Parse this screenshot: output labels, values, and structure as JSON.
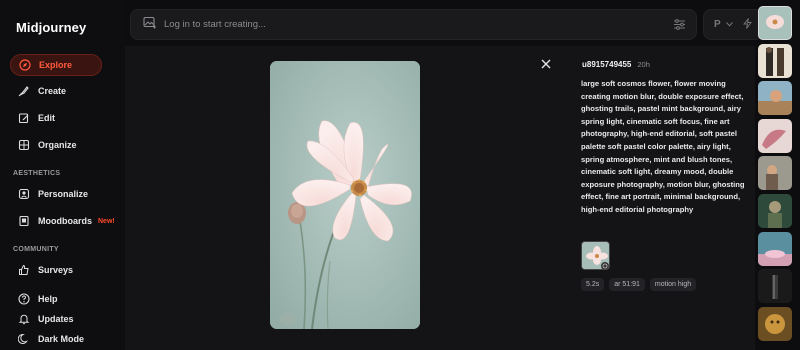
{
  "app": {
    "brand": "Midjourney"
  },
  "sidebar": {
    "items": [
      {
        "label": "Explore",
        "icon": "compass-icon",
        "active": true
      },
      {
        "label": "Create",
        "icon": "brush-icon"
      },
      {
        "label": "Edit",
        "icon": "edit-icon"
      },
      {
        "label": "Organize",
        "icon": "grid-icon"
      }
    ],
    "aesthetics_label": "AESTHETICS",
    "aesthetics": [
      {
        "label": "Personalize",
        "icon": "user-icon"
      },
      {
        "label": "Moodboards",
        "icon": "moodboard-icon",
        "badge": "New!"
      }
    ],
    "community_label": "COMMUNITY",
    "community": [
      {
        "label": "Surveys",
        "icon": "thumbs-up-icon"
      }
    ],
    "bottom": [
      {
        "label": "Help",
        "icon": "help-icon"
      },
      {
        "label": "Updates",
        "icon": "bell-icon"
      },
      {
        "label": "Dark Mode",
        "icon": "moon-icon"
      }
    ]
  },
  "search": {
    "placeholder": "Log in to start creating..."
  },
  "right_control": {
    "label": "P"
  },
  "detail": {
    "user": "u8915749455",
    "time": "20h",
    "prompt": "large soft cosmos flower, flower moving creating motion blur, double exposure effect, ghosting trails, pastel mint background, airy spring light, cinematic soft focus, fine art photography, high-end editorial, soft pastel palette soft pastel color palette, airy light, spring atmosphere, mint and blush tones, cinematic soft light, dreamy mood, double exposure photography, motion blur, ghosting effect, fine art portrait, minimal background, high-end editorial photography",
    "chips": [
      "5.2s",
      "ar 51:91",
      "motion high"
    ]
  },
  "colors": {
    "accent": "#ff5a3c",
    "background": "#0d0d0f",
    "preview_bg": "#a9c1bb"
  }
}
